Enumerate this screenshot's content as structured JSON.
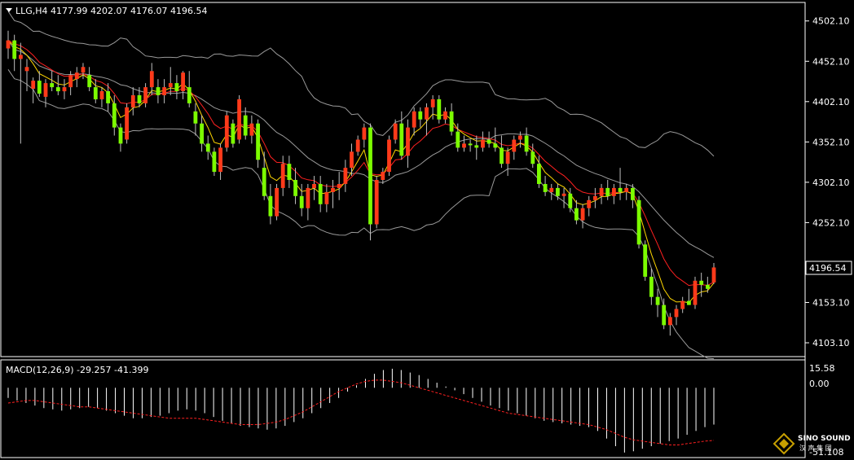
{
  "colors": {
    "background": "#000000",
    "frame": "#ffffff",
    "bull_candle": "#7CFC00",
    "bear_candle": "#ff3a1a",
    "wick": "#bfbfbf",
    "bollinger": "#9a9a9a",
    "ma_fast": "#ffd700",
    "ma_slow": "#ff2020",
    "macd_hist": "#ffffff",
    "macd_signal": "#ff2020",
    "price_box_bg": "#000000"
  },
  "header": {
    "symbol_line": "LLG,H4  4177.99 4202.07 4176.07 4196.54",
    "menu_icon": "triangle-down-icon"
  },
  "price_axis": {
    "labels": [
      "4502.10",
      "4452.10",
      "4402.10",
      "4352.10",
      "4302.10",
      "4252.10",
      "4153.10",
      "4103.10"
    ],
    "current_price": "4196.54"
  },
  "macd": {
    "title": "MACD(12,26,9) -29.257 -41.399",
    "labels": [
      "15.58",
      "0.00",
      "-51.108"
    ]
  },
  "watermark": {
    "name": "SINO SOUND",
    "sub": "汉 声 集 团"
  },
  "chart_data": {
    "type": "candlestick",
    "symbol": "LLG",
    "timeframe": "H4",
    "last": {
      "open": 4177.99,
      "high": 4202.07,
      "low": 4176.07,
      "close": 4196.54
    },
    "ylim": [
      4090,
      4520
    ],
    "candles_ohlc": [
      [
        4468,
        4490,
        4455,
        4478
      ],
      [
        4478,
        4485,
        4440,
        4455
      ],
      [
        4455,
        4475,
        4350,
        4460
      ],
      [
        4440,
        4455,
        4415,
        4445
      ],
      [
        4418,
        4432,
        4400,
        4428
      ],
      [
        4428,
        4440,
        4408,
        4412
      ],
      [
        4408,
        4430,
        4395,
        4425
      ],
      [
        4425,
        4440,
        4415,
        4420
      ],
      [
        4420,
        4435,
        4410,
        4415
      ],
      [
        4415,
        4430,
        4405,
        4420
      ],
      [
        4420,
        4440,
        4410,
        4435
      ],
      [
        4430,
        4445,
        4420,
        4438
      ],
      [
        4438,
        4450,
        4430,
        4445
      ],
      [
        4435,
        4445,
        4415,
        4420
      ],
      [
        4420,
        4430,
        4400,
        4405
      ],
      [
        4405,
        4420,
        4395,
        4415
      ],
      [
        4415,
        4425,
        4390,
        4400
      ],
      [
        4400,
        4410,
        4360,
        4370
      ],
      [
        4370,
        4375,
        4340,
        4350
      ],
      [
        4355,
        4400,
        4350,
        4395
      ],
      [
        4395,
        4420,
        4385,
        4410
      ],
      [
        4410,
        4420,
        4395,
        4400
      ],
      [
        4400,
        4425,
        4395,
        4420
      ],
      [
        4420,
        4450,
        4410,
        4440
      ],
      [
        4420,
        4430,
        4400,
        4410
      ],
      [
        4410,
        4430,
        4400,
        4420
      ],
      [
        4420,
        4445,
        4410,
        4425
      ],
      [
        4425,
        4435,
        4405,
        4415
      ],
      [
        4415,
        4440,
        4405,
        4438
      ],
      [
        4420,
        4440,
        4395,
        4400
      ],
      [
        4390,
        4400,
        4360,
        4375
      ],
      [
        4375,
        4385,
        4340,
        4350
      ],
      [
        4350,
        4360,
        4330,
        4340
      ],
      [
        4340,
        4345,
        4310,
        4315
      ],
      [
        4315,
        4350,
        4305,
        4345
      ],
      [
        4345,
        4390,
        4340,
        4385
      ],
      [
        4375,
        4380,
        4345,
        4350
      ],
      [
        4355,
        4410,
        4350,
        4405
      ],
      [
        4385,
        4395,
        4355,
        4360
      ],
      [
        4360,
        4385,
        4350,
        4375
      ],
      [
        4375,
        4380,
        4320,
        4330
      ],
      [
        4320,
        4340,
        4280,
        4285
      ],
      [
        4285,
        4300,
        4250,
        4260
      ],
      [
        4260,
        4300,
        4255,
        4295
      ],
      [
        4295,
        4335,
        4285,
        4325
      ],
      [
        4325,
        4335,
        4295,
        4305
      ],
      [
        4305,
        4320,
        4275,
        4285
      ],
      [
        4285,
        4300,
        4260,
        4270
      ],
      [
        4270,
        4300,
        4255,
        4295
      ],
      [
        4295,
        4310,
        4280,
        4300
      ],
      [
        4300,
        4310,
        4265,
        4275
      ],
      [
        4275,
        4300,
        4265,
        4290
      ],
      [
        4290,
        4305,
        4270,
        4295
      ],
      [
        4295,
        4315,
        4280,
        4300
      ],
      [
        4300,
        4330,
        4290,
        4320
      ],
      [
        4320,
        4350,
        4310,
        4340
      ],
      [
        4340,
        4360,
        4335,
        4355
      ],
      [
        4355,
        4375,
        4345,
        4370
      ],
      [
        4370,
        4375,
        4230,
        4250
      ],
      [
        4250,
        4310,
        4245,
        4305
      ],
      [
        4305,
        4320,
        4300,
        4315
      ],
      [
        4315,
        4360,
        4310,
        4355
      ],
      [
        4355,
        4380,
        4350,
        4375
      ],
      [
        4375,
        4390,
        4330,
        4335
      ],
      [
        4335,
        4380,
        4320,
        4370
      ],
      [
        4370,
        4395,
        4360,
        4390
      ],
      [
        4390,
        4395,
        4370,
        4380
      ],
      [
        4380,
        4400,
        4360,
        4395
      ],
      [
        4395,
        4410,
        4380,
        4405
      ],
      [
        4405,
        4410,
        4375,
        4380
      ],
      [
        4380,
        4395,
        4375,
        4390
      ],
      [
        4390,
        4400,
        4360,
        4365
      ],
      [
        4365,
        4375,
        4340,
        4345
      ],
      [
        4345,
        4360,
        4340,
        4350
      ],
      [
        4350,
        4355,
        4340,
        4348
      ],
      [
        4348,
        4360,
        4330,
        4345
      ],
      [
        4345,
        4365,
        4340,
        4355
      ],
      [
        4355,
        4365,
        4345,
        4350
      ],
      [
        4350,
        4370,
        4340,
        4345
      ],
      [
        4345,
        4360,
        4320,
        4325
      ],
      [
        4325,
        4345,
        4310,
        4340
      ],
      [
        4340,
        4360,
        4330,
        4355
      ],
      [
        4355,
        4365,
        4345,
        4360
      ],
      [
        4360,
        4370,
        4335,
        4340
      ],
      [
        4340,
        4350,
        4320,
        4325
      ],
      [
        4325,
        4335,
        4295,
        4300
      ],
      [
        4300,
        4310,
        4285,
        4290
      ],
      [
        4290,
        4300,
        4280,
        4295
      ],
      [
        4295,
        4300,
        4280,
        4285
      ],
      [
        4285,
        4295,
        4270,
        4288
      ],
      [
        4288,
        4295,
        4265,
        4270
      ],
      [
        4270,
        4280,
        4250,
        4255
      ],
      [
        4255,
        4275,
        4245,
        4270
      ],
      [
        4270,
        4285,
        4260,
        4280
      ],
      [
        4280,
        4295,
        4270,
        4285
      ],
      [
        4285,
        4300,
        4275,
        4295
      ],
      [
        4295,
        4305,
        4280,
        4285
      ],
      [
        4285,
        4300,
        4275,
        4295
      ],
      [
        4295,
        4320,
        4280,
        4290
      ],
      [
        4290,
        4300,
        4280,
        4295
      ],
      [
        4295,
        4300,
        4270,
        4280
      ],
      [
        4280,
        4285,
        4220,
        4225
      ],
      [
        4225,
        4230,
        4180,
        4185
      ],
      [
        4185,
        4195,
        4150,
        4160
      ],
      [
        4160,
        4170,
        4135,
        4150
      ],
      [
        4150,
        4158,
        4120,
        4125
      ],
      [
        4125,
        4140,
        4112,
        4135
      ],
      [
        4135,
        4150,
        4125,
        4145
      ],
      [
        4145,
        4160,
        4140,
        4155
      ],
      [
        4155,
        4170,
        4150,
        4150
      ],
      [
        4150,
        4185,
        4145,
        4180
      ],
      [
        4180,
        4190,
        4160,
        4175
      ],
      [
        4175,
        4185,
        4165,
        4170
      ],
      [
        4177.99,
        4202.07,
        4176.07,
        4196.54
      ]
    ],
    "macd_hist": [
      -8,
      -10,
      -12,
      -14,
      -16,
      -17,
      -18,
      -17,
      -16,
      -15,
      -16,
      -18,
      -20,
      -22,
      -24,
      -24,
      -23,
      -22,
      -20,
      -18,
      -17,
      -18,
      -20,
      -23,
      -26,
      -28,
      -30,
      -31,
      -32,
      -33,
      -32,
      -30,
      -27,
      -24,
      -20,
      -16,
      -12,
      -8,
      -3,
      2,
      7,
      11,
      14,
      15,
      14,
      12,
      10,
      7,
      4,
      1,
      -2,
      -5,
      -8,
      -11,
      -14,
      -16,
      -18,
      -20,
      -22,
      -24,
      -26,
      -27,
      -28,
      -29,
      -30,
      -31,
      -34,
      -40,
      -46,
      -51,
      -50,
      -48,
      -46,
      -44,
      -42,
      -40,
      -37,
      -34,
      -31,
      -29
    ],
    "macd_signal": [
      -12,
      -11,
      -10,
      -10,
      -11,
      -12,
      -13,
      -14,
      -15,
      -15,
      -16,
      -17,
      -18,
      -19,
      -20,
      -21,
      -22,
      -23,
      -24,
      -24,
      -24,
      -24,
      -25,
      -26,
      -27,
      -28,
      -29,
      -29,
      -29,
      -28,
      -27,
      -25,
      -22,
      -19,
      -15,
      -11,
      -7,
      -3,
      0,
      3,
      5,
      6,
      6,
      5,
      4,
      2,
      0,
      -2,
      -4,
      -6,
      -8,
      -10,
      -12,
      -14,
      -16,
      -18,
      -20,
      -21,
      -22,
      -23,
      -24,
      -25,
      -26,
      -27,
      -28,
      -29,
      -31,
      -33,
      -36,
      -39,
      -41,
      -42,
      -43,
      -44,
      -45,
      -45,
      -44,
      -43,
      -42,
      -41.399
    ],
    "macd_ylim": [
      -51.108,
      15.58
    ]
  }
}
